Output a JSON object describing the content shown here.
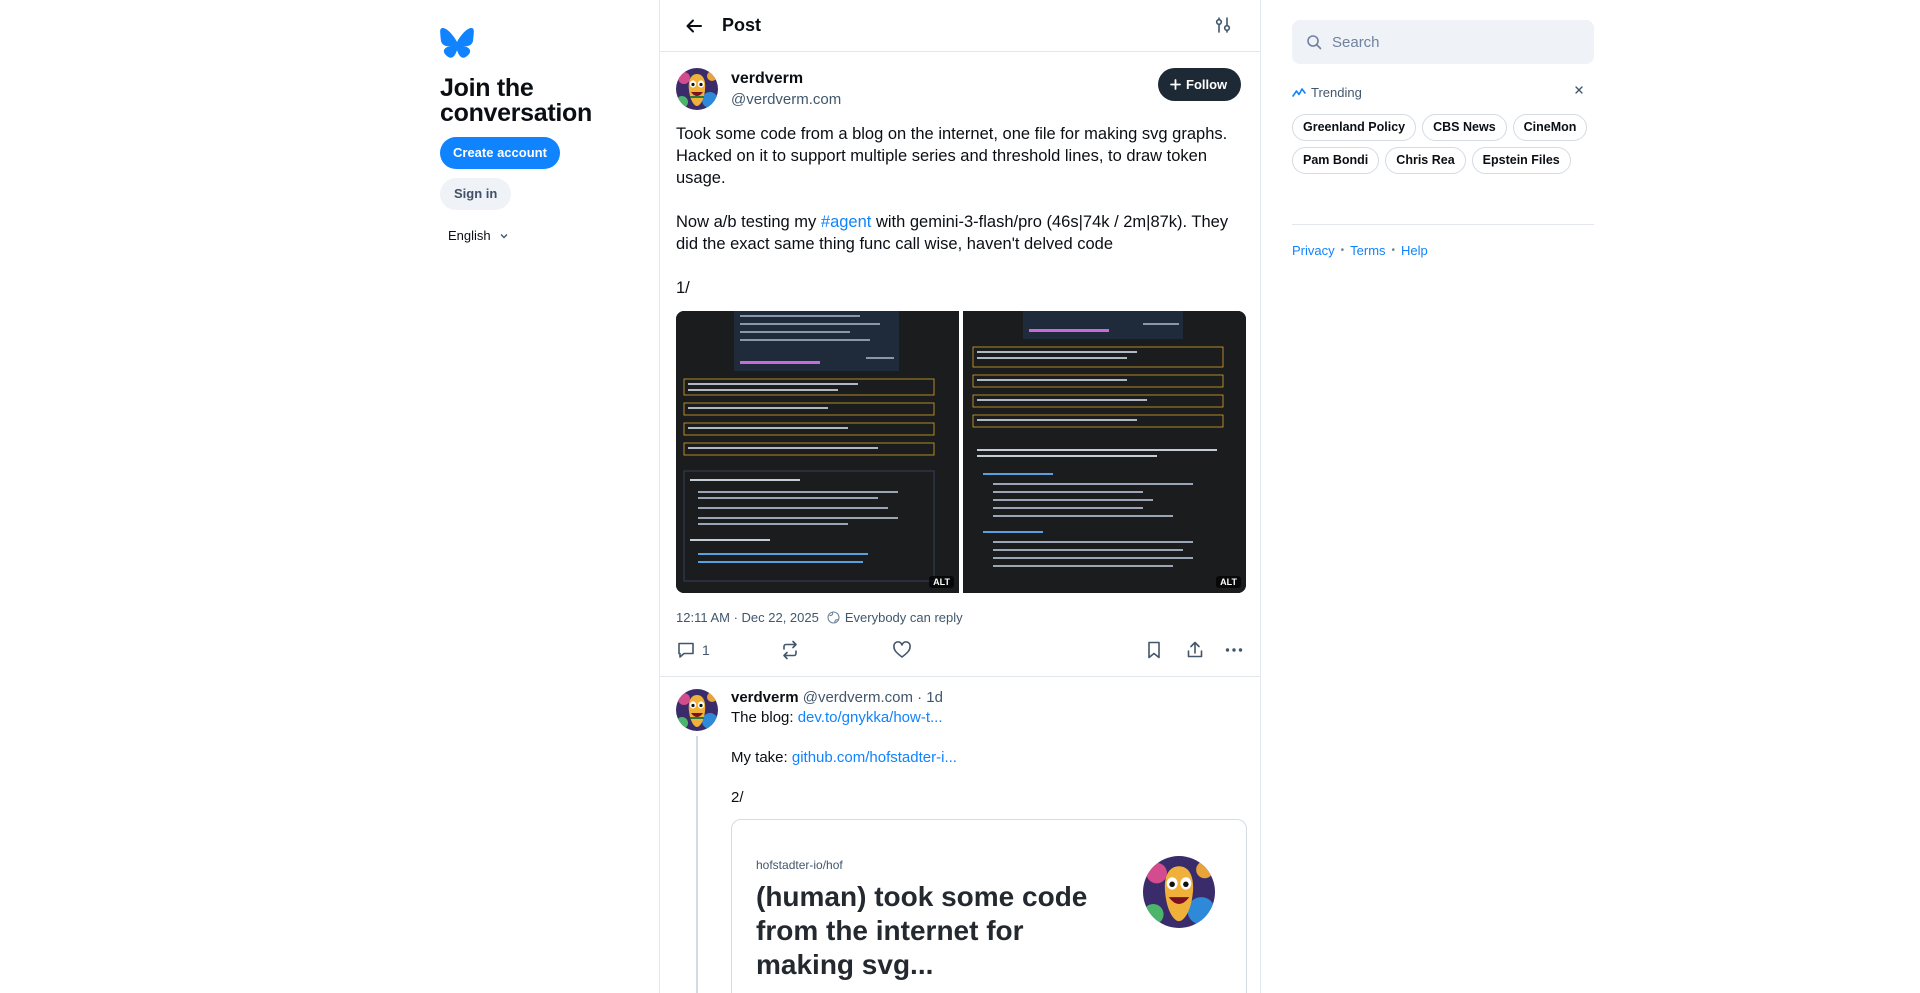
{
  "left": {
    "join_title": "Join the conversation",
    "create_account": "Create account",
    "sign_in": "Sign in",
    "language": "English"
  },
  "header": {
    "title": "Post"
  },
  "post": {
    "display_name": "verdverm",
    "handle": "@verdverm.com",
    "follow_label": "Follow",
    "text_p1": "Took some code from a blog on the internet, one file for making svg graphs. Hacked on it to support multiple series and threshold lines, to draw token usage.",
    "text_p2_before": "Now a/b testing my ",
    "text_p2_tag": "#agent",
    "text_p2_after": " with gemini-3-flash/pro (46s|74k / 2m|87k). They did the exact same thing func call wise, haven't delved code",
    "text_p3": "1/",
    "image1_alt": "ALT",
    "image2_alt": "ALT",
    "timestamp": "12:11 AM · Dec 22, 2025",
    "reply_setting": "Everybody can reply",
    "reply_count": "1"
  },
  "reply": {
    "display_name": "verdverm",
    "handle_time": "@verdverm.com · 1d",
    "line1_prefix": "The blog: ",
    "line1_link": "dev.to/gnykka/how-t...",
    "line2_prefix": "My take: ",
    "line2_link": "github.com/hofstadter-i...",
    "line3": "2/",
    "card_repo": "hofstadter-io/hof",
    "card_title": "(human) took some code from the internet for making svg..."
  },
  "right": {
    "search_placeholder": "Search",
    "trending_label": "Trending",
    "trending": [
      "Greenland Policy",
      "CBS News",
      "CineMon",
      "Pam Bondi",
      "Chris Rea",
      "Epstein Files"
    ],
    "links": [
      "Privacy",
      "Terms",
      "Help"
    ]
  },
  "colors": {
    "accent": "#1083fe",
    "text": "#0b0f14",
    "muted": "#42576c",
    "border": "#e3e8ee"
  }
}
